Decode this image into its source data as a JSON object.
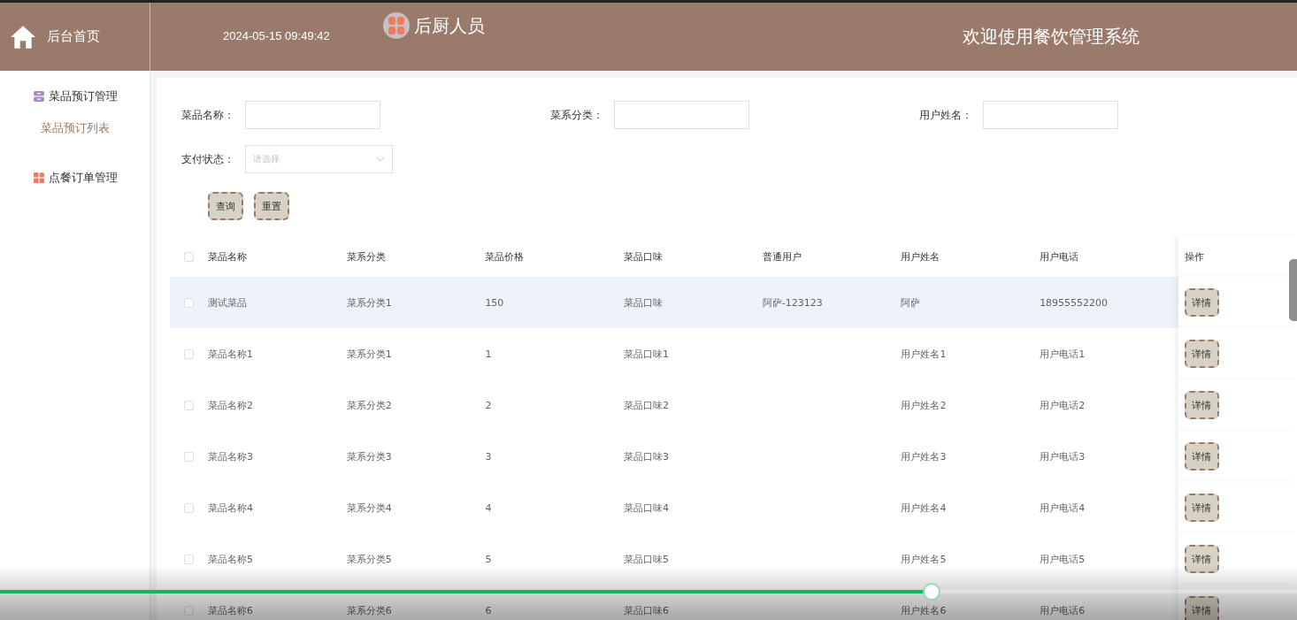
{
  "header": {
    "home_label": "后台首页",
    "datetime": "2024-05-15 09:49:42",
    "role": "后厨人员",
    "title": "欢迎使用餐饮管理系统"
  },
  "sidebar": {
    "items": [
      {
        "label": "菜品预订管理",
        "kind": "cabinet",
        "selected": false,
        "children": [
          {
            "label": "菜品预订列表",
            "selected": true
          }
        ]
      },
      {
        "label": "点餐订单管理",
        "kind": "blocks",
        "selected": false
      }
    ]
  },
  "filters": [
    {
      "label": "菜品名称：",
      "kind": "input"
    },
    {
      "label": "菜系分类：",
      "kind": "input"
    },
    {
      "label": "用户姓名：",
      "kind": "input"
    },
    {
      "label": "支付状态：",
      "kind": "select",
      "placeholder": "请选择"
    }
  ],
  "buttons": [
    "查询",
    "重置"
  ],
  "table": {
    "select_all_checked": false,
    "columns": [
      "菜品名称",
      "菜系分类",
      "菜品价格",
      "菜品口味",
      "普通用户",
      "用户姓名",
      "用户电话"
    ],
    "action_column": "操作",
    "rows": [
      {
        "checked": false,
        "hovered": true,
        "cells": [
          "测试菜品",
          "菜系分类1",
          "150",
          "菜品口味",
          "阿萨-123123",
          "阿萨",
          "18955552200"
        ],
        "action": "详情"
      },
      {
        "checked": false,
        "hovered": false,
        "cells": [
          "菜品名称1",
          "菜系分类1",
          "1",
          "菜品口味1",
          "",
          "用户姓名1",
          "用户电话1"
        ],
        "action": "详情"
      },
      {
        "checked": false,
        "hovered": false,
        "cells": [
          "菜品名称2",
          "菜系分类2",
          "2",
          "菜品口味2",
          "",
          "用户姓名2",
          "用户电话2"
        ],
        "action": "详情"
      },
      {
        "checked": false,
        "hovered": false,
        "cells": [
          "菜品名称3",
          "菜系分类3",
          "3",
          "菜品口味3",
          "",
          "用户姓名3",
          "用户电话3"
        ],
        "action": "详情"
      },
      {
        "checked": false,
        "hovered": false,
        "cells": [
          "菜品名称4",
          "菜系分类4",
          "4",
          "菜品口味4",
          "",
          "用户姓名4",
          "用户电话4"
        ],
        "action": "详情"
      },
      {
        "checked": false,
        "hovered": false,
        "cells": [
          "菜品名称5",
          "菜系分类5",
          "5",
          "菜品口味5",
          "",
          "用户姓名5",
          "用户电话5"
        ],
        "action": "详情"
      },
      {
        "checked": false,
        "hovered": false,
        "cells": [
          "菜品名称6",
          "菜系分类6",
          "6",
          "菜品口味6",
          "",
          "用户姓名6",
          "用户电话6"
        ],
        "action": "详情"
      }
    ]
  },
  "seek_bar": {
    "level": 0.718
  }
}
